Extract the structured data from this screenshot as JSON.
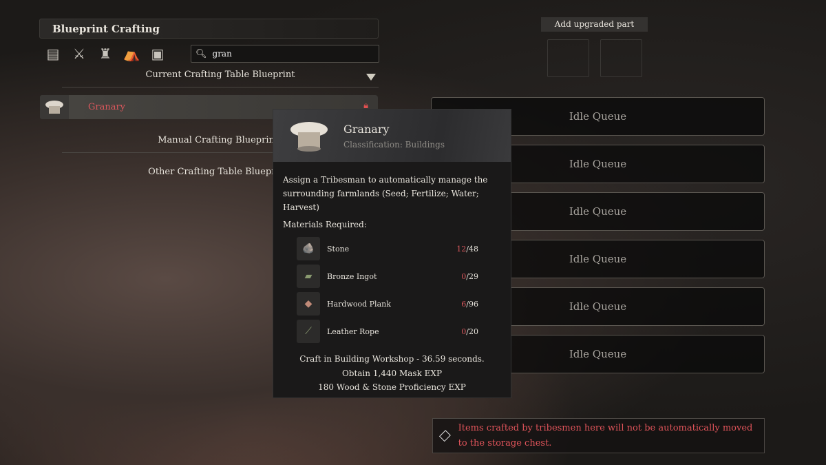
{
  "panel": {
    "title": "Blueprint Crafting",
    "categories": [
      "materials-icon",
      "weapons-icon",
      "armor-icon",
      "tent-icon",
      "blocks-icon"
    ],
    "search": {
      "value": "gran"
    },
    "sections": {
      "current": "Current Crafting Table Blueprint",
      "manual": "Manual Crafting Blueprints",
      "other": "Other Crafting Table Blueprints"
    },
    "items": [
      {
        "label": "Granary",
        "locked": true
      }
    ]
  },
  "tooltip": {
    "name": "Granary",
    "classification": "Classification: Buildings",
    "description": "Assign a Tribesman to automatically manage the surrounding farmlands (Seed; Fertilize; Water; Harvest)",
    "materials_label": "Materials Required:",
    "materials": [
      {
        "name": "Stone",
        "have": "12",
        "need": "/48"
      },
      {
        "name": "Bronze Ingot",
        "have": "0",
        "need": "/29"
      },
      {
        "name": "Hardwood Plank",
        "have": "6",
        "need": "/96"
      },
      {
        "name": "Leather Rope",
        "have": "0",
        "need": "/20"
      }
    ],
    "footer": [
      "Craft in Building Workshop - 36.59 seconds.",
      "Obtain 1,440 Mask EXP",
      "180 Wood & Stone Proficiency EXP"
    ]
  },
  "right": {
    "add_part": "Add upgraded part",
    "queues": [
      "Idle Queue",
      "Idle Queue",
      "Idle Queue",
      "Idle Queue",
      "Idle Queue",
      "Idle Queue"
    ],
    "notice": "Items crafted by tribesmen here will not be automatically moved to the storage chest."
  },
  "colors": {
    "warning": "#d9575c"
  }
}
